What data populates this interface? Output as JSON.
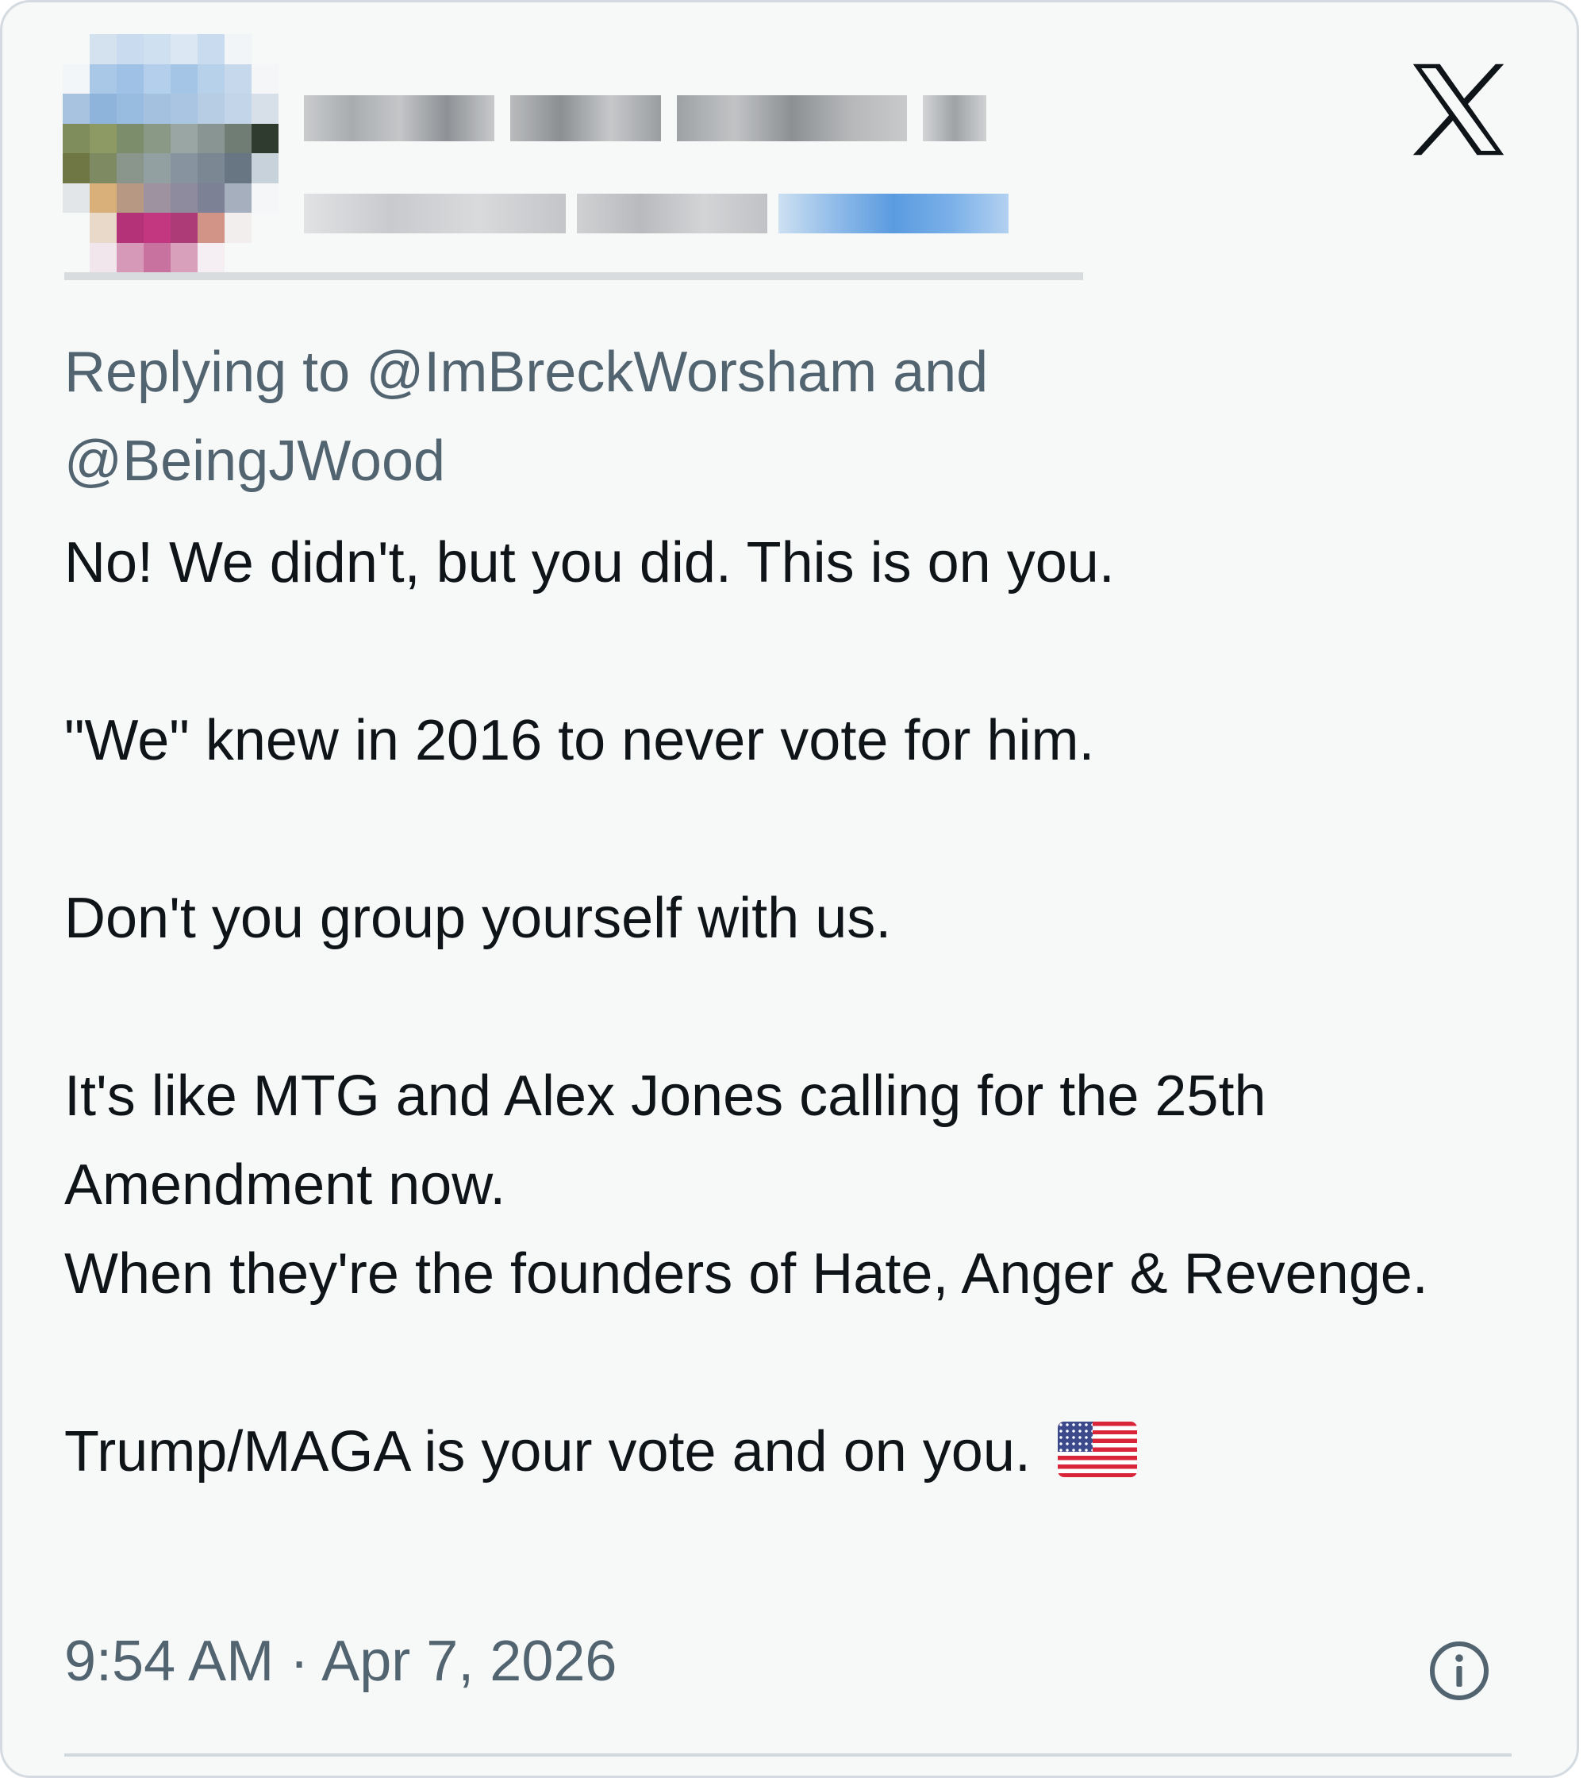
{
  "tweet": {
    "replying_prefix": "Replying to ",
    "mention_1": "@ImBreckWorsham",
    "replying_and": " and",
    "mention_2": "@BeingJWood",
    "body": [
      "No! We didn't, but you did. This is on you.",
      "\"We\" knew in 2016 to never vote for him.",
      "Don't you group yourself with us.",
      "It's like MTG and Alex Jones calling for the 25th Amendment now.\nWhen they're the founders of Hate, Anger & Revenge.",
      "Trump/MAGA is your vote and on you. "
    ],
    "timestamp": "9:54 AM · Apr 7, 2026"
  },
  "icons": {
    "logo": "x-logo-icon",
    "info": "info-icon",
    "flag": "us-flag-emoji"
  },
  "colors": {
    "card_background": "#f7f9f9",
    "primary_text": "#0f1419",
    "secondary_text": "#536471",
    "border": "#d3dbe1"
  }
}
